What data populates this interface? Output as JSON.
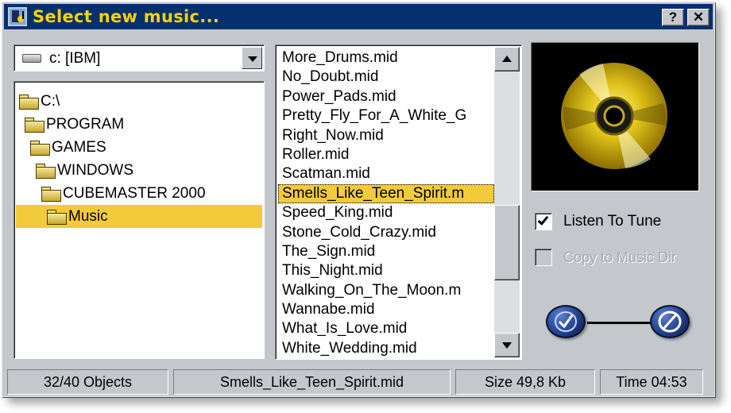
{
  "window": {
    "title": "Select new music...",
    "help_label": "?",
    "close_label": "✕"
  },
  "drive": {
    "label": "c: [IBM]"
  },
  "tree": {
    "items": [
      {
        "label": "C:\\"
      },
      {
        "label": "PROGRAM"
      },
      {
        "label": "GAMES"
      },
      {
        "label": "WINDOWS"
      },
      {
        "label": "CUBEMASTER 2000"
      },
      {
        "label": "Music",
        "selected": true
      }
    ]
  },
  "files": {
    "items": [
      "More_Drums.mid",
      "No_Doubt.mid",
      "Power_Pads.mid",
      "Pretty_Fly_For_A_White_G",
      "Right_Now.mid",
      "Roller.mid",
      "Scatman.mid",
      "Smells_Like_Teen_Spirit.m",
      "Speed_King.mid",
      "Stone_Cold_Crazy.mid",
      "The_Sign.mid",
      "This_Night.mid",
      "Walking_On_The_Moon.m",
      "Wannabe.mid",
      "What_Is_Love.mid",
      "White_Wedding.mid"
    ],
    "selected_index": 7,
    "scroll_fraction": 0.72
  },
  "options": {
    "listen": {
      "label": "Listen To Tune",
      "checked": true
    },
    "copy": {
      "label": "Copy to Music Dir",
      "checked": false,
      "disabled": true
    }
  },
  "status": {
    "objects": "32/40 Objects",
    "filename": "Smells_Like_Teen_Spirit.mid",
    "size": "Size 49,8 Kb",
    "time": "Time 04:53"
  },
  "icons": {
    "app": "music-app-icon",
    "drive": "hard-drive-icon",
    "folder": "folder-icon",
    "cd": "cd-disc-icon",
    "ok": "ok-check-icon",
    "cancel": "cancel-circle-icon"
  },
  "colors": {
    "title_bar": "#05306e",
    "title_text": "#ffd200",
    "selection": "#f2cb3c",
    "window_face": "#c4c8cc",
    "disc": "#e0c21a"
  }
}
